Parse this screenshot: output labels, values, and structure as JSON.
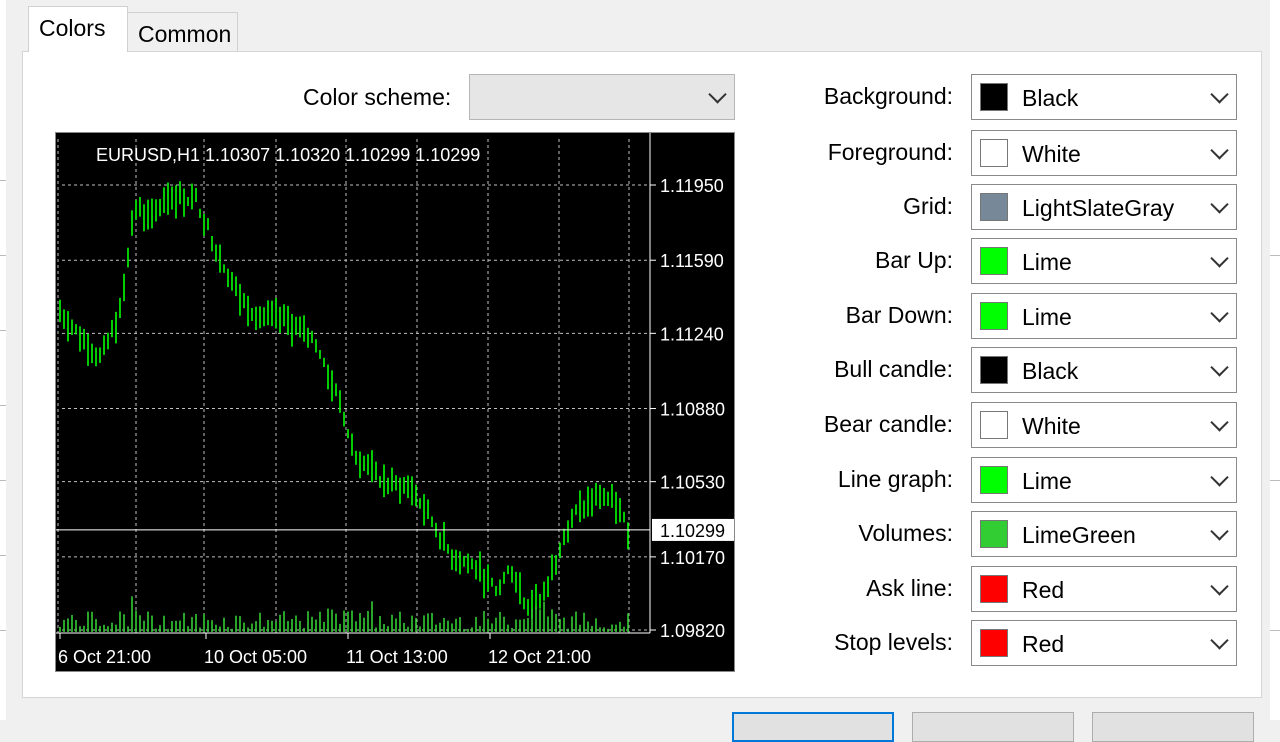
{
  "tabs": [
    {
      "label": "Colors",
      "active": true
    },
    {
      "label": "Common",
      "active": false
    }
  ],
  "color_scheme": {
    "label": "Color scheme:",
    "value": ""
  },
  "preview": {
    "header": "EURUSD,H1  1.10307 1.10320 1.10299 1.10299",
    "price_labels": [
      "1.11950",
      "1.11590",
      "1.11240",
      "1.10880",
      "1.10530",
      "1.10170",
      "1.09820"
    ],
    "current_price": "1.10299",
    "time_labels": [
      "6 Oct 21:00",
      "10 Oct 05:00",
      "11 Oct 13:00",
      "12 Oct 21:00"
    ]
  },
  "settings": [
    {
      "label": "Background:",
      "value": "Black",
      "color": "#000000"
    },
    {
      "label": "Foreground:",
      "value": "White",
      "color": "#ffffff"
    },
    {
      "label": "Grid:",
      "value": "LightSlateGray",
      "color": "#778899"
    },
    {
      "label": "Bar Up:",
      "value": "Lime",
      "color": "#00ff00"
    },
    {
      "label": "Bar Down:",
      "value": "Lime",
      "color": "#00ff00"
    },
    {
      "label": "Bull candle:",
      "value": "Black",
      "color": "#000000"
    },
    {
      "label": "Bear candle:",
      "value": "White",
      "color": "#ffffff"
    },
    {
      "label": "Line graph:",
      "value": "Lime",
      "color": "#00ff00"
    },
    {
      "label": "Volumes:",
      "value": "LimeGreen",
      "color": "#32cd32"
    },
    {
      "label": "Ask line:",
      "value": "Red",
      "color": "#ff0000"
    },
    {
      "label": "Stop levels:",
      "value": "Red",
      "color": "#ff0000"
    }
  ]
}
